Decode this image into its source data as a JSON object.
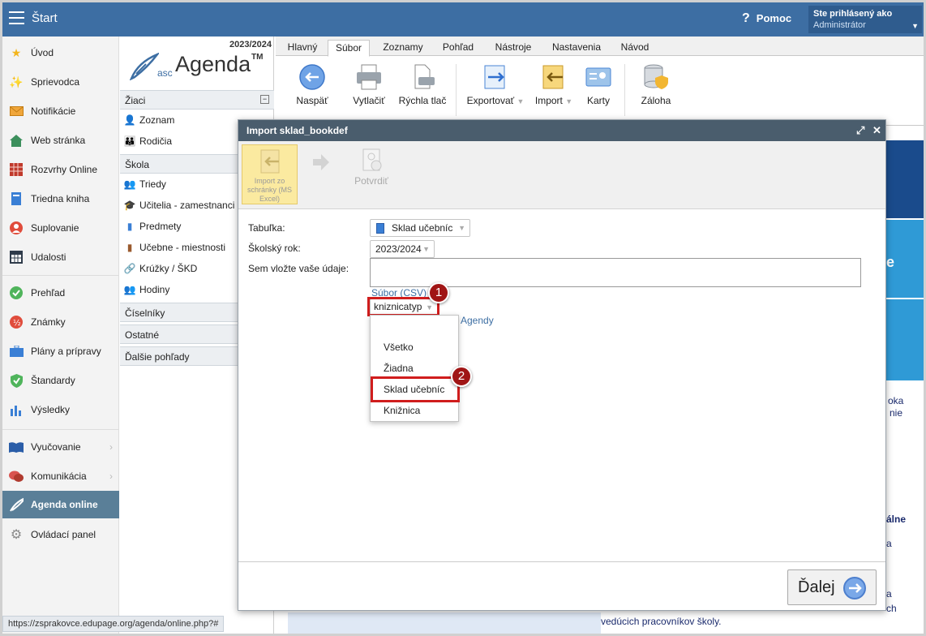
{
  "topbar": {
    "start": "Štart",
    "help": "Pomoc",
    "logged_in_as": "Ste prihlásený ako",
    "user": "Administrátor"
  },
  "leftnav": [
    {
      "label": "Úvod",
      "icon": "star-icon"
    },
    {
      "label": "Sprievodca",
      "icon": "wand-icon"
    },
    {
      "label": "Notifikácie",
      "icon": "envelope-icon"
    },
    {
      "label": "Web stránka",
      "icon": "house-icon"
    },
    {
      "label": "Rozvrhy Online",
      "icon": "grid-icon"
    },
    {
      "label": "Triedna kniha",
      "icon": "book-icon"
    },
    {
      "label": "Suplovanie",
      "icon": "person-icon"
    },
    {
      "label": "Udalosti",
      "icon": "calendar-icon"
    },
    {
      "label": "Prehľad",
      "icon": "check-circle-icon"
    },
    {
      "label": "Známky",
      "icon": "grade-icon"
    },
    {
      "label": "Plány a prípravy",
      "icon": "briefcase-icon"
    },
    {
      "label": "Štandardy",
      "icon": "shield-check-icon"
    },
    {
      "label": "Výsledky",
      "icon": "bar-chart-icon"
    },
    {
      "label": "Vyučovanie",
      "icon": "open-book-icon"
    },
    {
      "label": "Komunikácia",
      "icon": "chat-icon"
    },
    {
      "label": "Agenda online",
      "icon": "quill-icon"
    },
    {
      "label": "Ovládací panel",
      "icon": "gear-icon"
    }
  ],
  "status_url": "https://zsprakovce.edupage.org/agenda/online.php?#",
  "agenda": {
    "year": "2023/2024",
    "logo_asc": "asc",
    "logo_word": "Agenda",
    "logo_tm": "TM",
    "sections": {
      "ziaci": "Žiaci",
      "skola": "Škola",
      "ciselniky": "Číselníky",
      "ostatne": "Ostatné",
      "dalsie": "Ďalšie pohľady"
    },
    "items": {
      "zoznam": "Zoznam",
      "rodicia": "Rodičia",
      "triedy": "Triedy",
      "ucitelia": "Učitelia - zamestnanci",
      "predmety": "Predmety",
      "ucebne": "Učebne - miestnosti",
      "kruzky": "Krúžky / ŠKD",
      "hodiny": "Hodiny"
    }
  },
  "ribbon": {
    "tabs": [
      "Hlavný",
      "Súbor",
      "Zoznamy",
      "Pohľad",
      "Nástroje",
      "Nastavenia",
      "Návod"
    ],
    "buttons": {
      "back": "Naspäť",
      "print": "Vytlačiť",
      "quick_print": "Rýchla tlač",
      "export": "Exportovať",
      "import": "Import",
      "cards": "Karty",
      "backup": "Záloha"
    }
  },
  "background": {
    "side_letter": "e",
    "t1": "oka",
    "t2": "nie",
    "t3": "álne",
    "t4": "a",
    "t5": "a",
    "t6": "ch",
    "bottom": "vedúcich pracovníkov školy."
  },
  "dialog": {
    "title": "Import sklad_bookdef",
    "step1": "Import zo schránky (MS Excel)",
    "step2": "Potvrdiť",
    "label_table": "Tabuľka:",
    "table_value": "Sklad učebníc",
    "label_year": "Školský rok:",
    "year_value": "2023/2024",
    "label_data": "Sem vložte vaše údaje:",
    "csv_link": "Súbor (CSV)",
    "type_value": "kniznicatyp",
    "agenda_link": "Agendy",
    "menu": [
      "Všetko",
      "Žiadna",
      "Sklad učebníc",
      "Knižnica"
    ],
    "next": "Ďalej"
  },
  "annotations": {
    "badge1": "1",
    "badge2": "2",
    "highlight_color": "#d01d1d"
  }
}
